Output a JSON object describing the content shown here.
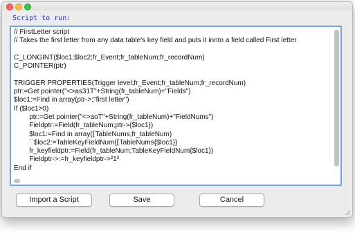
{
  "window": {
    "controls": [
      "close",
      "minimize",
      "zoom"
    ]
  },
  "editor": {
    "label": "Script to run:",
    "lines": [
      "// FirstLetter script",
      "// Takes the first letter from any data table's key field and puts it innto a field called First letter",
      "",
      "C_LONGINT($loc1;$loc2;fr_Event;fr_tableNum;fr_recordNum)",
      "C_POINTER(ptr)",
      "",
      "TRIGGER PROPERTIES(Trigger level;fr_Event;fr_tableNum;fr_recordNum)",
      "ptr:=Get pointer(\"<>as31T\"+String(fr_tableNum)+\"Fields\")",
      "$loc1:=Find in array(ptr->;\"first letter\")",
      "If ($loc1>0)",
      "        ptr:=Get pointer(\"<>aoT\"+String(fr_tableNum)+\"FieldNums\")",
      "        Fieldptr:=Field(fr_tableNum;ptr->{$loc1})",
      "        $loc1:=Find in array(⁅TableNums;fr_tableNum)",
      "        ``$loc2:=TableKeyFieldNum{⁅TableNums{$loc1}}",
      "        fr_keyfieldptr:=Field(fr_tableNum;TableKeyFieldNum{$loc1})",
      "        Fieldptr->:=fr_keyfieldptr->²1³",
      "End if"
    ]
  },
  "buttons": {
    "import": "Import a Script",
    "save": "Save",
    "cancel": "Cancel"
  }
}
